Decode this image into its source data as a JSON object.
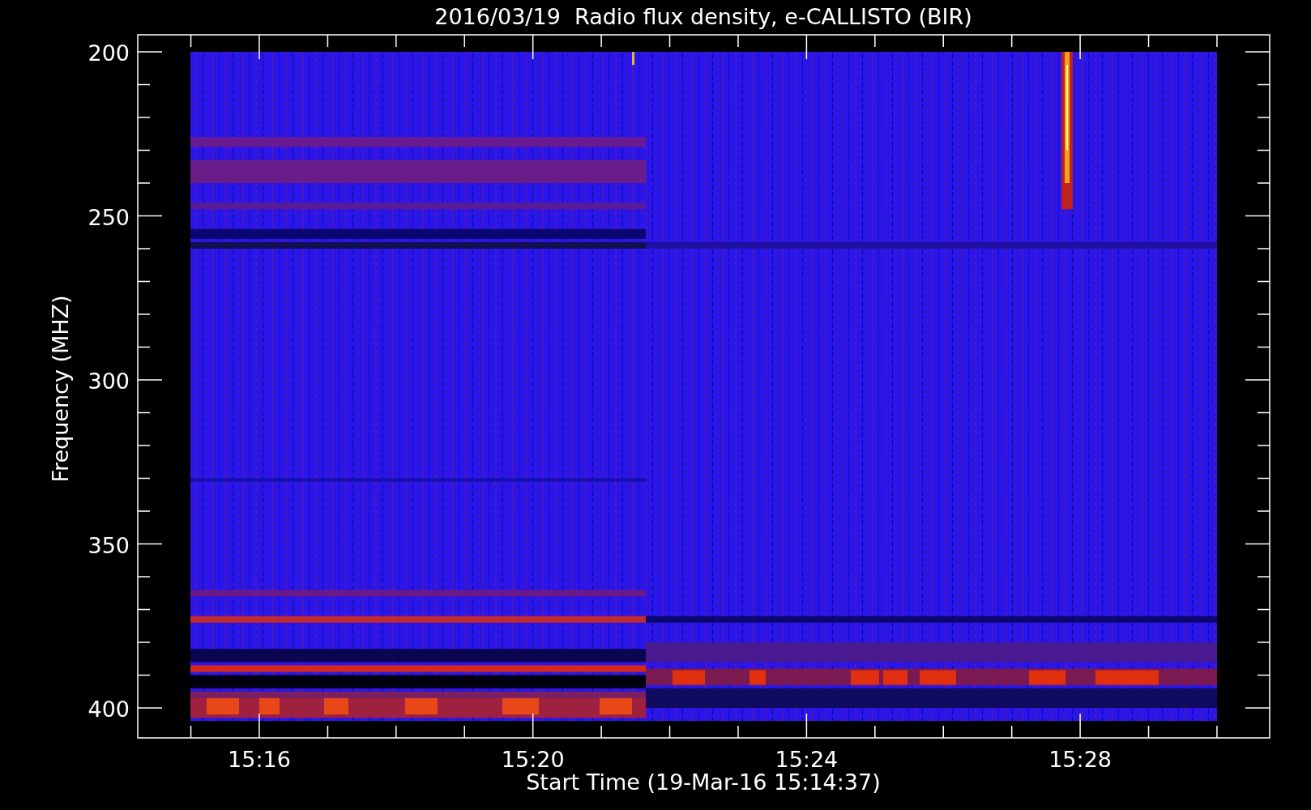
{
  "title": "2016/03/19  Radio flux density, e-CALLISTO (BIR)",
  "ylabel": "Frequency (MHZ)",
  "xlabel": "Start Time (19-Mar-16 15:14:37)",
  "yticks": [
    "200",
    "250",
    "300",
    "350",
    "400"
  ],
  "xticks": [
    "15:16",
    "15:20",
    "15:24",
    "15:28"
  ]
}
